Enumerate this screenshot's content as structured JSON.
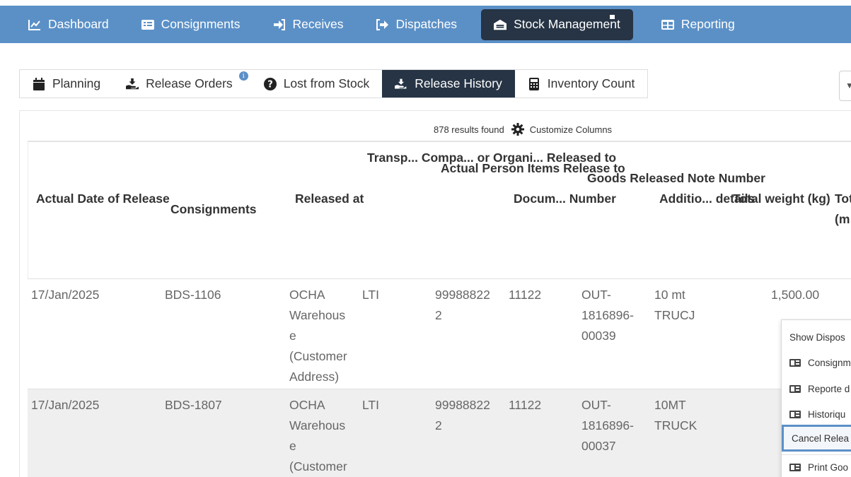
{
  "topnav": {
    "items": [
      {
        "label": "Dashboard",
        "icon": "line-chart-icon"
      },
      {
        "label": "Consignments",
        "icon": "list-card-icon"
      },
      {
        "label": "Receives",
        "icon": "sign-in-icon"
      },
      {
        "label": "Dispatches",
        "icon": "sign-out-icon"
      },
      {
        "label": "Stock Management",
        "icon": "warehouse-icon",
        "active": true
      },
      {
        "label": "Reporting",
        "icon": "table-icon"
      }
    ]
  },
  "subtabs": {
    "items": [
      {
        "label": "Planning",
        "icon": "calendar-icon"
      },
      {
        "label": "Release Orders",
        "icon": "hand-up-icon",
        "badge": "i"
      },
      {
        "label": "Lost from Stock",
        "icon": "question-circle-icon"
      },
      {
        "label": "Release History",
        "icon": "hand-release-icon",
        "active": true
      },
      {
        "label": "Inventory Count",
        "icon": "calculator-icon"
      }
    ],
    "dropdown_glyph": "▼"
  },
  "table": {
    "results_text": "878 results found",
    "customize_label": "Customize Columns",
    "headers": [
      [
        "Actual Date of",
        "Release"
      ],
      [
        "Consignments"
      ],
      [
        "Released",
        "at"
      ],
      [
        "Transp...",
        "Compa...",
        "or",
        "Organi...",
        "Released",
        "to"
      ],
      [
        "Actual",
        "Person",
        "Items",
        "Release",
        "to"
      ],
      [
        "Docum...",
        "Number"
      ],
      [
        "Goods",
        "Released",
        "Note",
        "Number"
      ],
      [
        "Additio...",
        "details"
      ],
      [
        "Total weight",
        "(kg)"
      ],
      [
        "Tot",
        "(m"
      ]
    ],
    "rows": [
      {
        "date": "17/Jan/2025",
        "consignment": "BDS-1106",
        "released_at": [
          "OCHA",
          "Warehous",
          "e",
          "(Customer",
          "Address)"
        ],
        "transport": "LTI",
        "person": [
          "99988822",
          "2"
        ],
        "document": "11122",
        "grn": [
          "OUT-",
          "1816896-",
          "00039"
        ],
        "details": [
          "10 mt",
          "TRUCJ"
        ],
        "weight": "1,500.00"
      },
      {
        "date": "17/Jan/2025",
        "consignment": "BDS-1807",
        "released_at": [
          "OCHA",
          "Warehous",
          "e",
          "(Customer"
        ],
        "transport": "LTI",
        "person": [
          "99988822",
          "2"
        ],
        "document": "11122",
        "grn": [
          "OUT-",
          "1816896-",
          "00037"
        ],
        "details": [
          "10MT",
          "TRUCK"
        ],
        "weight": ""
      }
    ]
  },
  "context_menu": {
    "items": [
      {
        "label": "Show Dispos",
        "icon": ""
      },
      {
        "label": "Consignm",
        "icon": "id-card-icon"
      },
      {
        "label": "Reporte d",
        "icon": "id-card-icon"
      },
      {
        "label": "Historiqu",
        "icon": "id-card-icon"
      },
      {
        "label": "Cancel Relea",
        "icon": "",
        "highlighted": true
      },
      {
        "label": "Print Goo",
        "icon": "id-card-icon"
      }
    ]
  },
  "colors": {
    "nav_bg": "#5b90c7",
    "active_bg": "#263445",
    "row_alt_bg": "#efefef"
  }
}
